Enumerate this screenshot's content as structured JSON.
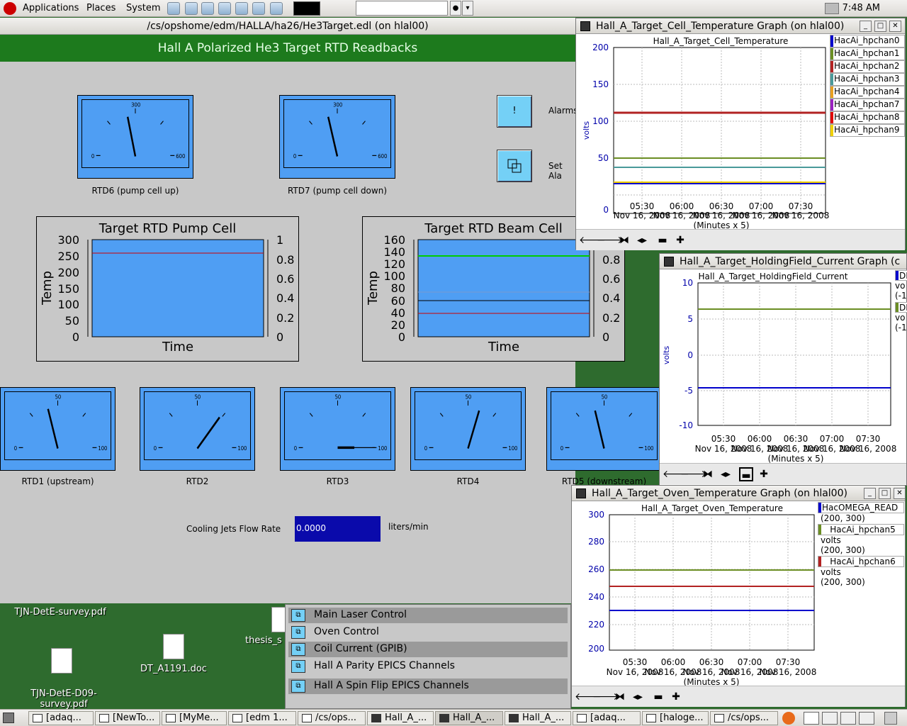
{
  "top_panel": {
    "menus": [
      "Applications",
      "Places",
      "System"
    ],
    "clock": "7:48 AM"
  },
  "edm": {
    "title": "/cs/opshome/edm/HALLA/ha26/He3Target.edl (on hlal00)",
    "header": "Hall A Polarized He3 Target RTD Readbacks",
    "meters_top": [
      {
        "label": "RTD6 (pump cell up)",
        "min": "0",
        "mid": "300",
        "max": "600"
      },
      {
        "label": "RTD7 (pump cell down)",
        "min": "0",
        "mid": "300",
        "max": "600"
      }
    ],
    "meters_bottom": [
      {
        "label": "RTD1 (upstream)",
        "min": "0",
        "mid": "50",
        "max": "100"
      },
      {
        "label": "RTD2",
        "min": "0",
        "mid": "50",
        "max": "100"
      },
      {
        "label": "RTD3",
        "min": "0",
        "mid": "50",
        "max": "100"
      },
      {
        "label": "RTD4",
        "min": "0",
        "mid": "50",
        "max": "100"
      },
      {
        "label": "RTD5 (downstream)",
        "min": "0",
        "mid": "50",
        "max": "100"
      }
    ],
    "alarms_btn": "!",
    "alarms_label": "Alarms",
    "set_alarms_label": "Set Ala",
    "pump_plot": {
      "title": "Target RTD Pump Cell",
      "ylabel": "Temp",
      "xlabel": "Time",
      "yticks": [
        "300",
        "250",
        "200",
        "150",
        "100",
        "50",
        "0"
      ],
      "y2ticks": [
        "1",
        "0.8",
        "0.6",
        "0.4",
        "0.2",
        "0"
      ]
    },
    "beam_plot": {
      "title": "Target RTD Beam Cell",
      "ylabel": "Temp",
      "xlabel": "Time",
      "yticks": [
        "160",
        "140",
        "120",
        "100",
        "80",
        "60",
        "40",
        "20",
        "0"
      ],
      "y2ticks": [
        "0.8",
        "0.6",
        "0.4",
        "0.2",
        "0"
      ]
    },
    "flow_label": "Cooling Jets Flow Rate",
    "flow_value": "0.0000",
    "flow_unit": "liters/min"
  },
  "desktop": {
    "icons": [
      "TJN-DetE-survey.pdf",
      "TJN-DetE-D09-\nsurvey.pdf",
      "DT_A1191.doc",
      "thesis_s"
    ]
  },
  "menu_panel": {
    "items": [
      "Main Laser Control",
      "Oven Control",
      "Coil Current (GPIB)",
      "Hall A Parity EPICS Channels",
      "Hall A Spin Flip EPICS Channels"
    ]
  },
  "graph1": {
    "title": "Hall_A_Target_Cell_Temperature Graph (on hlal00)",
    "plot_title": "Hall_A_Target_Cell_Temperature",
    "ylabel": "volts",
    "xaxis_note": "(Minutes x 5)",
    "xticks": [
      "05:30",
      "06:00",
      "06:30",
      "07:00",
      "07:30"
    ],
    "xdates": [
      "Nov 16, 2008",
      "Nov 16, 2008",
      "Nov 16, 2008",
      "Nov 16, 2008",
      "Nov 16, 2008"
    ],
    "yticks": [
      "200",
      "150",
      "100",
      "50",
      "0"
    ],
    "legend": [
      {
        "name": "HacAi_hpchan0",
        "color": "#0000cc"
      },
      {
        "name": "HacAi_hpchan1",
        "color": "#6b8e23"
      },
      {
        "name": "HacAi_hpchan2",
        "color": "#b22222"
      },
      {
        "name": "HacAi_hpchan3",
        "color": "#4a9a9a"
      },
      {
        "name": "HacAi_hpchan4",
        "color": "#e8a020"
      },
      {
        "name": "HacAi_hpchan7",
        "color": "#9a20c0"
      },
      {
        "name": "HacAi_hpchan8",
        "color": "#e00000"
      },
      {
        "name": "HacAi_hpchan9",
        "color": "#f0d000"
      }
    ]
  },
  "graph2": {
    "title": "Hall_A_Target_HoldingField_Current Graph (c",
    "plot_title": "Hall_A_Target_HoldingField_Current",
    "ylabel": "volts",
    "xaxis_note": "(Minutes x 5)",
    "xticks": [
      "05:30",
      "06:00",
      "06:30",
      "07:00",
      "07:30"
    ],
    "xdates": [
      "Nov 16, 2008",
      "Nov 16, 2008",
      "Nov 16, 2008",
      "Nov 16, 2008",
      "Nov 16, 2008"
    ],
    "yticks": [
      "10",
      "5",
      "0",
      "-5",
      "-10"
    ],
    "legend_fragments": [
      "DD",
      "vo",
      "(-1",
      "DD",
      "vo",
      "(-1"
    ]
  },
  "graph3": {
    "title": "Hall_A_Target_Oven_Temperature Graph (on hlal00)",
    "plot_title": "Hall_A_Target_Oven_Temperature",
    "xaxis_note": "(Minutes x 5)",
    "xticks": [
      "05:30",
      "06:00",
      "06:30",
      "07:00",
      "07:30"
    ],
    "xdates": [
      "Nov 16, 2008",
      "Nov 16, 2008",
      "Nov 16, 2008",
      "Nov 16, 2008",
      "Nov 16, 2008"
    ],
    "yticks": [
      "300",
      "280",
      "260",
      "240",
      "220",
      "200"
    ],
    "legend": [
      {
        "name": "HacOMEGA_READ",
        "sub": "(200, 300)",
        "color": "#0000cc"
      },
      {
        "name": "HacAi_hpchan5",
        "unit": "volts",
        "sub": "(200, 300)",
        "color": "#6b8e23"
      },
      {
        "name": "HacAi_hpchan6",
        "unit": "volts",
        "sub": "(200, 300)",
        "color": "#b22222"
      }
    ]
  },
  "taskbar": {
    "tasks": [
      "[adaq...",
      "[NewTo...",
      "[MyMe...",
      "[edm 1...",
      "/cs/ops...",
      "Hall_A_...",
      "Hall_A_...",
      "Hall_A_...",
      "[adaq...",
      "[haloge...",
      "/cs/ops..."
    ]
  }
}
